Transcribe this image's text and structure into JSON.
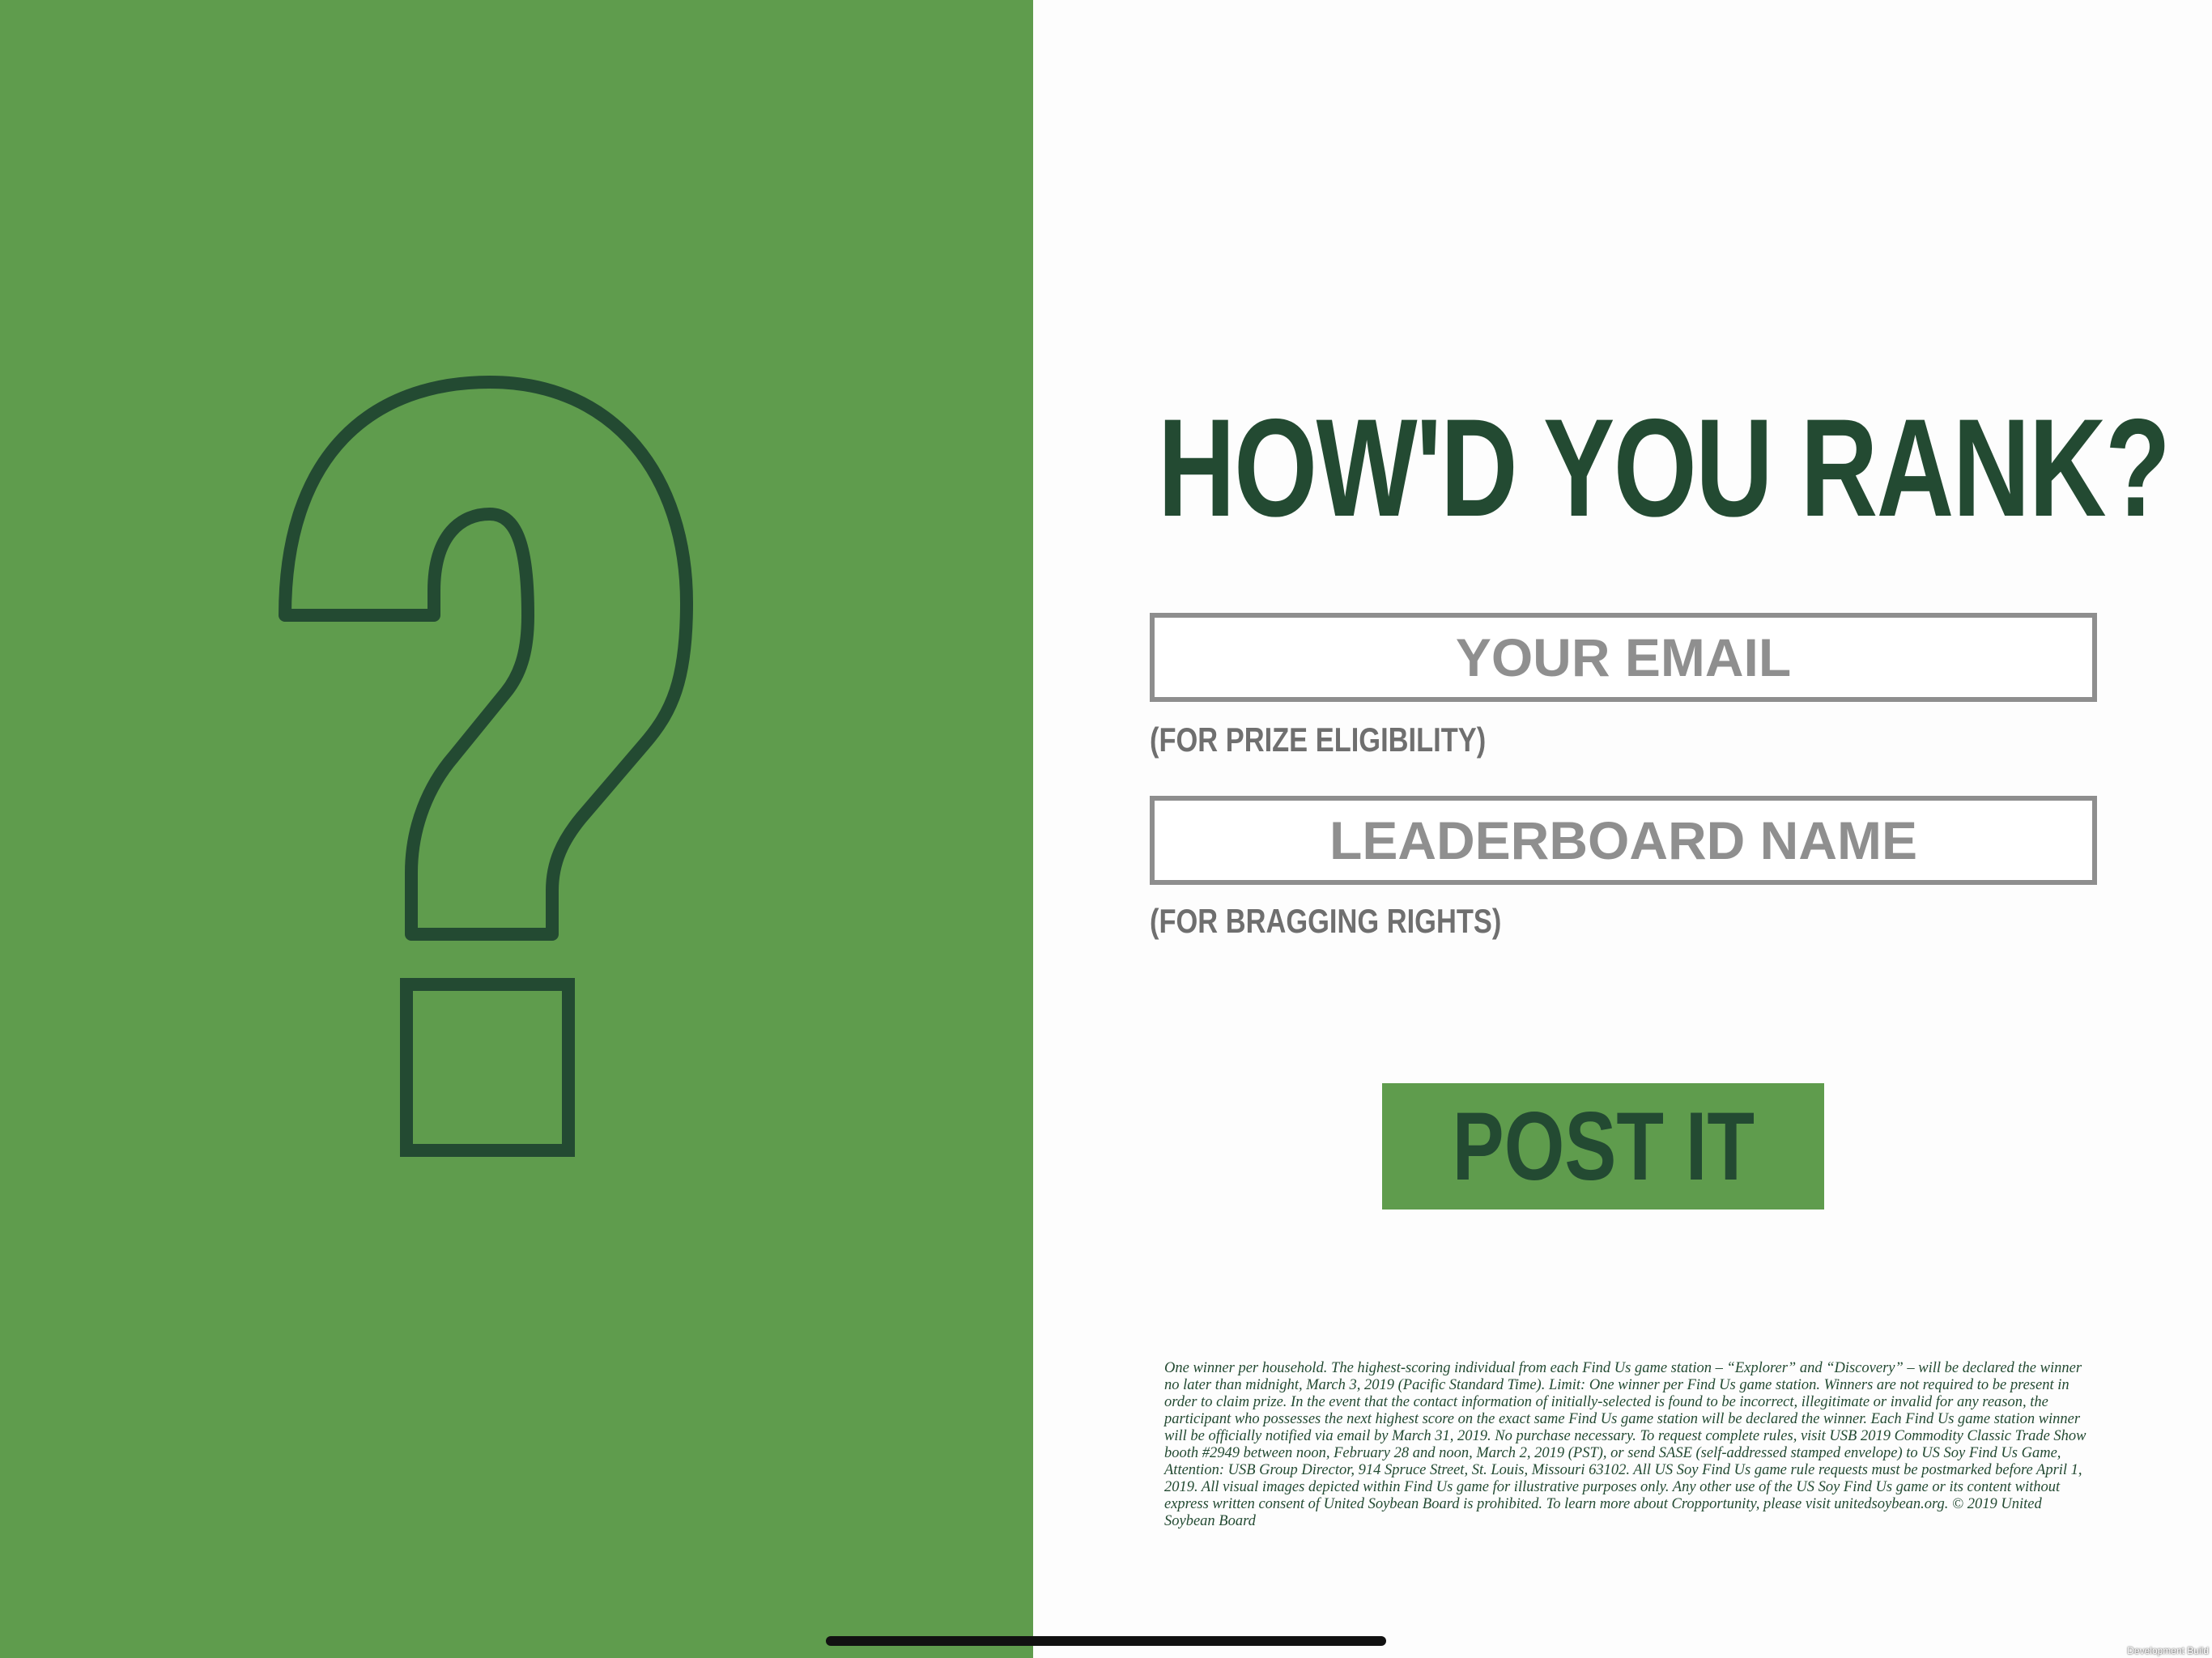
{
  "colors": {
    "brand_green": "#5f9c4d",
    "dark_green": "#234a32",
    "field_gray": "#8e8e8e",
    "background": "#fdfdfd"
  },
  "left_panel": {
    "icon": "question-mark-outline-icon"
  },
  "form": {
    "title": "HOW'D YOU RANK?",
    "email_placeholder": "YOUR EMAIL",
    "email_hint": "(FOR PRIZE ELIGIBILITY)",
    "leaderboard_placeholder": "LEADERBOARD NAME",
    "leaderboard_hint": "(FOR BRAGGING RIGHTS)",
    "submit_label": "POST IT"
  },
  "disclaimer": "One winner per household. The highest-scoring individual from each Find Us game station – “Explorer” and “Discovery” – will be declared the winner no later than midnight, March 3, 2019 (Pacific Standard Time). Limit: One winner per Find Us game station. Winners are not required to be present in order to claim prize. In the event that the contact information of initially-selected is found to be incorrect, illegitimate or invalid for any reason, the participant who possesses the next highest score on the exact same Find Us game station will be declared the winner. Each Find Us game station winner will be officially notified via email by March 31, 2019. No purchase necessary. To request complete rules, visit USB 2019 Commodity Classic Trade Show booth #2949 between noon, February 28 and noon, March 2, 2019 (PST), or send SASE (self-addressed stamped envelope) to US Soy Find Us Game, Attention: USB Group Director, 914 Spruce Street, St. Louis, Missouri 63102. All US Soy Find Us game rule requests must be postmarked before April 1, 2019. All visual images depicted within Find Us game for illustrative purposes only. Any other use of the US Soy Find Us game or its content without express written consent of United Soybean Board is prohibited. To learn more about Cropportunity, please visit unitedsoybean.org. © 2019 United Soybean Board",
  "build_label": "Development Build"
}
